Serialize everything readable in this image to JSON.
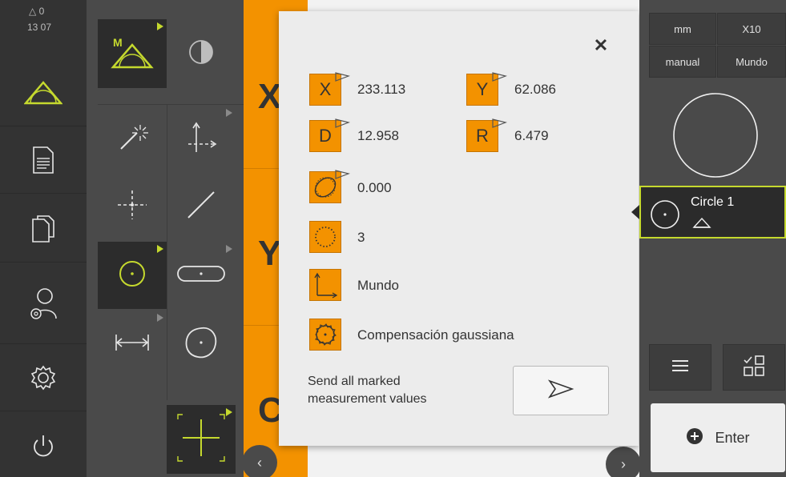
{
  "status": {
    "line1": "△ 0",
    "line2": "13 07"
  },
  "mainmenu": {
    "items": [
      "measure-icon",
      "protocol-icon",
      "file-management-icon",
      "user-login-icon",
      "settings-icon",
      "power-icon"
    ]
  },
  "palette": {
    "measure_mode_label": "M",
    "tools": [
      "measure-magic-icon",
      "coordinate-system-icon",
      "point-icon",
      "line-icon",
      "circle-icon",
      "slot-icon",
      "distance-icon",
      "blob-icon",
      "crosshair-icon"
    ]
  },
  "position_display": {
    "axes": [
      "X",
      "Y",
      "C"
    ]
  },
  "dialog": {
    "close_label": "✕",
    "rows": [
      {
        "label": "X",
        "value": "233.113"
      },
      {
        "label": "Y",
        "value": "62.086"
      },
      {
        "label": "D",
        "value": "12.958"
      },
      {
        "label": "R",
        "value": "6.479"
      }
    ],
    "form_error": "0.000",
    "points": "3",
    "coordinate_system": "Mundo",
    "fitting_algorithm": "Compensación gaussiana",
    "send_text": "Send all marked measurement values"
  },
  "inspector": {
    "unit": "mm",
    "zoom": "X10",
    "mode": "manual",
    "coord": "Mundo",
    "feature_name": "Circle 1",
    "enter_label": "Enter"
  },
  "colors": {
    "accent_orange": "#f39200",
    "accent_green": "#c5d92e",
    "dark": "#333333"
  }
}
